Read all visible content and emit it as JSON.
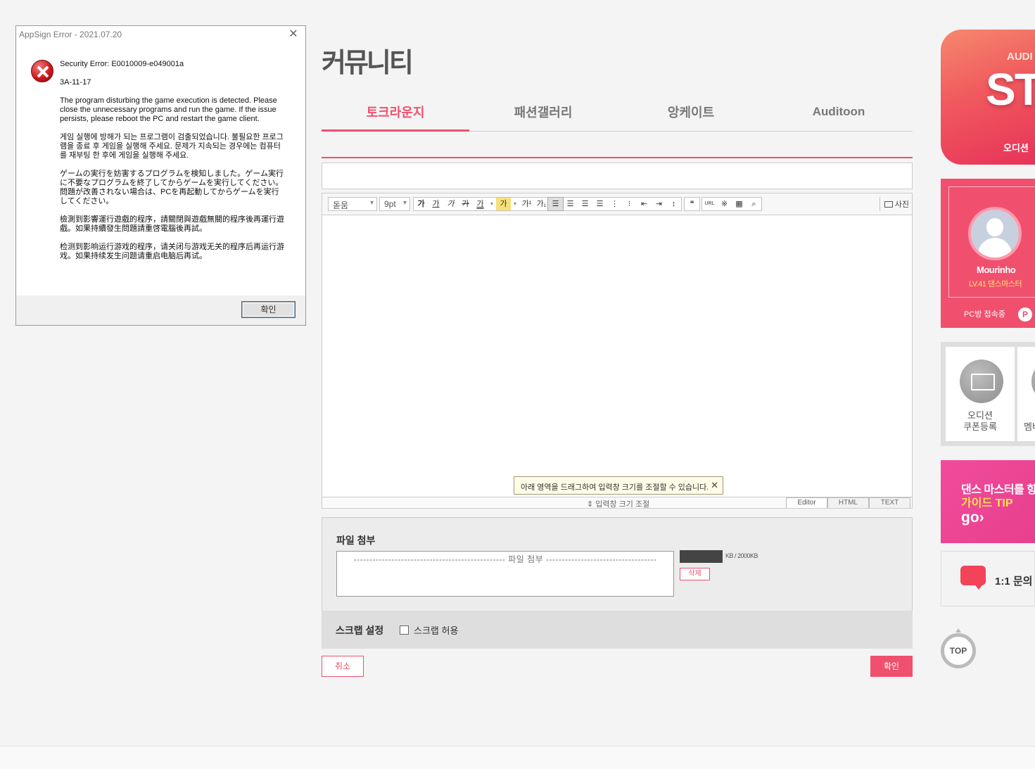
{
  "dialog": {
    "title": "AppSign Error - 2021.07.20",
    "close_icon": "close-icon",
    "error_icon": "error-icon",
    "error_code": "Security Error: E0010009-e049001a",
    "sub_code": "3A-11-17",
    "msg_en": "The program disturbing the game execution is detected. Please close the unnecessary programs and run the game. If the issue persists, please reboot the PC and restart the game client.",
    "msg_ko": "게임 실행에 방해가 되는 프로그램이 검출되었습니다. 불필요한 프로그램을 종료 후 게임을 실행해 주세요. 문제가 지속되는 경우에는 컴퓨터를 재부팅 한 후에 게임을 실행해 주세요.",
    "msg_ja": "ゲームの実行を妨害するプログラムを検知しました。ゲーム実行に不要なプログラムを終了してからゲームを実行してください。問題が改善されない場合は、PCを再起動してからゲームを実行してください。",
    "msg_zh_tw": "檢測到影響運行遊戲的程序，請關閉與遊戲無關的程序後再運行遊戲。如果持續發生問題請重啓電腦後再試。",
    "msg_zh_cn": "检测到影响运行游戏的程序，请关闭与游戏无关的程序后再运行游戏。如果持续发生问题请重启电脑后再试。",
    "ok_label": "확인"
  },
  "page": {
    "title": "커뮤니티",
    "tabs": [
      {
        "label": "토크라운지"
      },
      {
        "label": "패션갤러리"
      },
      {
        "label": "앙케이트"
      },
      {
        "label": "Auditoon"
      }
    ]
  },
  "editor": {
    "font_select": "돋움",
    "size_select": "9pt",
    "format_buttons": [
      "가",
      "가",
      "가",
      "가",
      "가"
    ],
    "color_btn": "가",
    "sup_btn": "가¹",
    "sub_btn": "가₁",
    "url_btn": "URL",
    "photo_label": "사진",
    "resize_tip": "아래 영역을 드래그하여 입력창 크기를 조절할 수 있습니다.",
    "resize_label": "⇕ 입력창 크기 조절",
    "modes": [
      "Editor",
      "HTML",
      "TEXT"
    ]
  },
  "attach": {
    "title": "파일 첨부",
    "box_label": "------------------------------------------------ 파일 첨부 -----------------------------------",
    "size_text": "KB / 2000KB",
    "delete_label": "삭제"
  },
  "scrap": {
    "title": "스크랩 설정",
    "allow_label": "스크랩 허용"
  },
  "actions": {
    "cancel_label": "취소",
    "ok_label": "확인"
  },
  "side": {
    "banner_line1": "AUDI",
    "banner_line2": "ST",
    "banner_line3": "오디션 ",
    "profile": {
      "nickname": "Mourinho",
      "level": "LV.41 댄스마스터",
      "pc_status": "PC방   접속중",
      "badge": "P"
    },
    "quick": {
      "coupon_label": "오디션\n쿠폰등록",
      "member_label": "멤버"
    },
    "guide": {
      "line1": "댄스 마스터를 향",
      "line2": "가이드 TIP",
      "line3": "go›"
    },
    "inquiry_label": "1:1 문의",
    "top_label": "TOP"
  }
}
